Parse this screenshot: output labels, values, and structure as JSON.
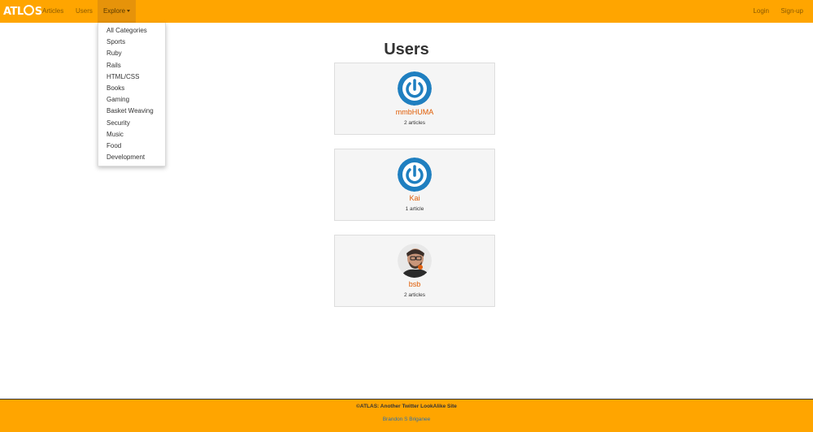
{
  "nav": {
    "brand": "ATL○S",
    "articles": "Articles",
    "users": "Users",
    "explore": "Explore",
    "login": "Login",
    "signup": "Sign-up",
    "accent_color": "#ffa500"
  },
  "explore_menu": {
    "items": [
      "All Categories",
      "Sports",
      "Ruby",
      "Rails",
      "HTML/CSS",
      "Books",
      "Gaming",
      "Basket Weaving",
      "Security",
      "Music",
      "Food",
      "Development"
    ]
  },
  "main": {
    "title": "Users",
    "users": [
      {
        "name": "mmbHUMA",
        "articles": "2 articles",
        "avatar": "power-icon"
      },
      {
        "name": "Kai",
        "articles": "1 article",
        "avatar": "power-icon"
      },
      {
        "name": "bsb",
        "articles": "2 articles",
        "avatar": "photo"
      }
    ]
  },
  "footer": {
    "copyright": "©ATLAS: Another Twitter LookAlike Site",
    "author": "Brandon S Briganee"
  }
}
